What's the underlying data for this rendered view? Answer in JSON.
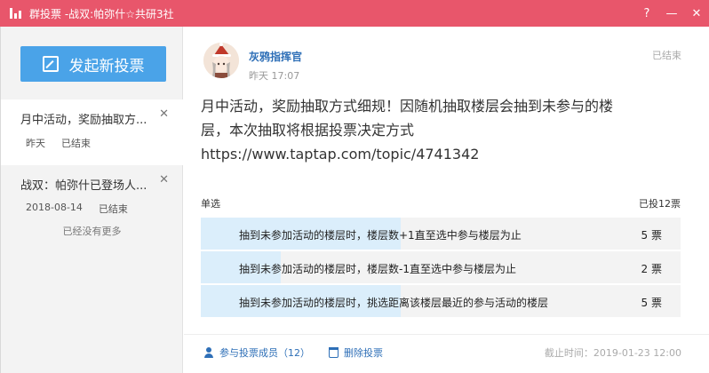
{
  "window": {
    "title": "群投票 -战双:帕弥什☆共研3社",
    "controls": [
      "?",
      "—",
      "✕"
    ]
  },
  "sidebar": {
    "new_vote_label": "发起新投票",
    "items": [
      {
        "title": "月中活动，奖励抽取方...",
        "date": "昨天",
        "status": "已结束"
      },
      {
        "title": "战双：帕弥什已登场人...",
        "date": "2018-08-14",
        "status": "已结束"
      }
    ],
    "no_more": "已经没有更多"
  },
  "post": {
    "author": "灰鸦指挥官",
    "time": "昨天 17:07",
    "status": "已结束",
    "content_lines": [
      "月中活动，奖励抽取方式细规！因随机抽取楼层会抽到未参与的楼",
      "层，本次抽取将根据投票决定方式",
      "https://www.taptap.com/topic/4741342"
    ]
  },
  "vote": {
    "type": "单选",
    "total": "已投12票",
    "options": [
      {
        "text": "抽到未参加活动的楼层时，楼层数+1直至选中参与楼层为止",
        "votes": "5 票",
        "fraction": 0.4167
      },
      {
        "text": "抽到未参加活动的楼层时，楼层数-1直至选中参与楼层为止",
        "votes": "2 票",
        "fraction": 0.1667
      },
      {
        "text": "抽到未参加活动的楼层时，挑选距离该楼层最近的参与活动的楼层",
        "votes": "5 票",
        "fraction": 0.4167
      }
    ]
  },
  "footer": {
    "members_label": "参与投票成员（12）",
    "delete_label": "删除投票",
    "deadline": "截止时间：2019-01-23 12:00"
  },
  "colors": {
    "titlebar": "#e8566b",
    "accent": "#4aa3e8",
    "link": "#2e6fb7",
    "vote_fill": "#dbeefb"
  }
}
